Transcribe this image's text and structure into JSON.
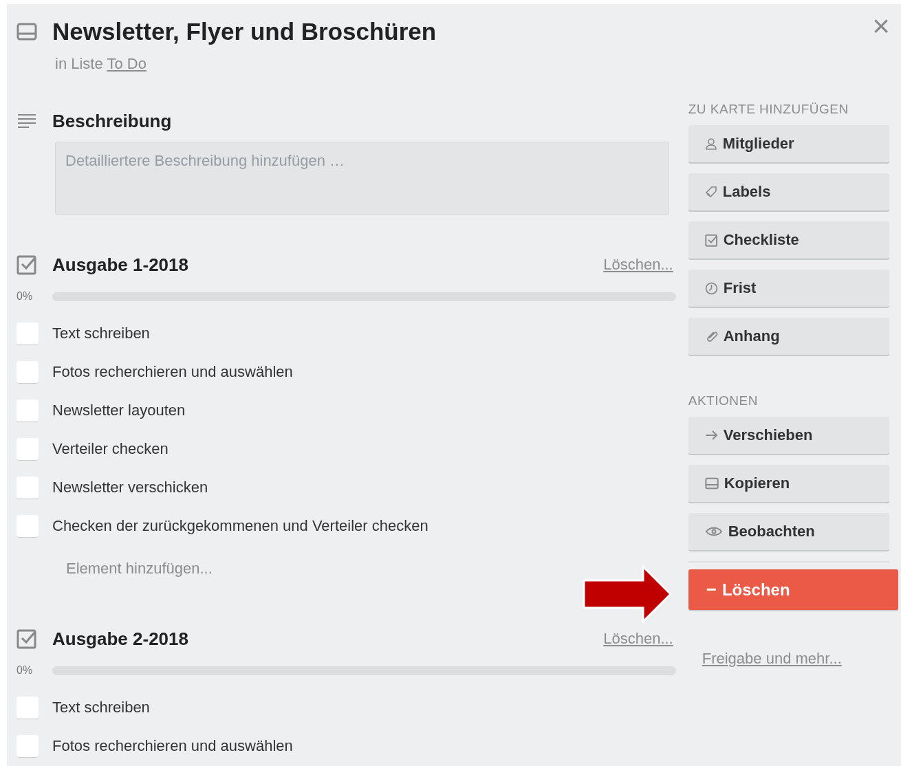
{
  "card": {
    "title": "Newsletter, Flyer und Broschüren",
    "list_prefix": "in Liste",
    "list_link": "To Do",
    "close": "×"
  },
  "description": {
    "heading": "Beschreibung",
    "placeholder": "Detailliertere Beschreibung hinzufügen …"
  },
  "checklists": [
    {
      "title": "Ausgabe 1-2018",
      "delete": "Löschen...",
      "percent": "0%",
      "level": 0,
      "add_item": "Element hinzufügen...",
      "items": [
        {
          "text": "Text schreiben",
          "checked": false
        },
        {
          "text": "Fotos recherchieren und auswählen",
          "checked": false
        },
        {
          "text": "Newsletter layouten",
          "checked": false
        },
        {
          "text": "Verteiler checken",
          "checked": false
        },
        {
          "text": "Newsletter verschicken",
          "checked": false
        },
        {
          "text": "Checken der zurückgekommenen und Verteiler checken",
          "checked": false
        }
      ]
    },
    {
      "title": "Ausgabe 2-2018",
      "delete": "Löschen...",
      "percent": "0%",
      "level": 0,
      "items": [
        {
          "text": "Text schreiben",
          "checked": false
        },
        {
          "text": "Fotos recherchieren und auswählen",
          "checked": false
        }
      ]
    }
  ],
  "sidebar": {
    "add_heading": "ZU KARTE HINZUFÜGEN",
    "add_buttons": [
      "Mitglieder",
      "Labels",
      "Checkliste",
      "Frist",
      "Anhang"
    ],
    "actions_heading": "AKTIONEN",
    "action_buttons": [
      "Verschieben",
      "Kopieren",
      "Beobachten"
    ],
    "delete_button": {
      "minus": "−",
      "label": "Löschen"
    },
    "share_link": "Freigabe und mehr..."
  }
}
